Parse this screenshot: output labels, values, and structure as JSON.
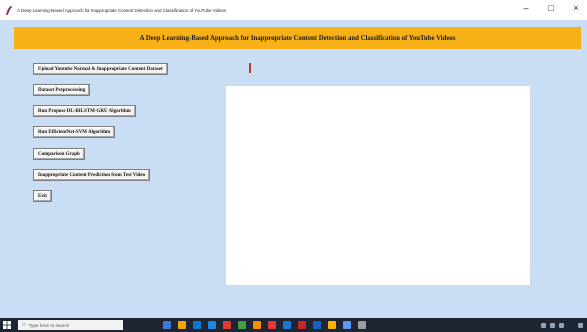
{
  "window": {
    "title": "A Deep Learning-Based Approach for Inappropriate Content Detection and Classification of YouTube Videos",
    "controls": [
      "–",
      "□",
      "×"
    ]
  },
  "header": {
    "title": "A Deep Learning-Based Approach for Inappropriate Content Detection and Classification of YouTube Videos",
    "background": "#f7b117"
  },
  "buttons": [
    "Upload Youtube Normal & Inappropriate Content Dataset",
    "Dataset Preprocessing",
    "Run Propose DL-BILSTM-GRU Algorithm",
    "Run EfficientNet-SVM Algorithm",
    "Comparison Graph",
    "Inappropriate Content Prediction from Test Video",
    "Exit"
  ],
  "output": {
    "value": ""
  },
  "taskbar": {
    "search_placeholder": "Type here to search",
    "icon_colors": [
      "#3a7bd5",
      "#f0a500",
      "#0b78d1",
      "#1e88e5",
      "#e53935",
      "#43a047",
      "#fb8c00",
      "#e53935",
      "#1976d2",
      "#c62828",
      "#1565c0",
      "#ffb300",
      "#5e97f6",
      "#9e9e9e"
    ],
    "clock_time": "",
    "clock_date": ""
  },
  "colors": {
    "background": "#c9def5",
    "taskbar": "#1e2633"
  }
}
